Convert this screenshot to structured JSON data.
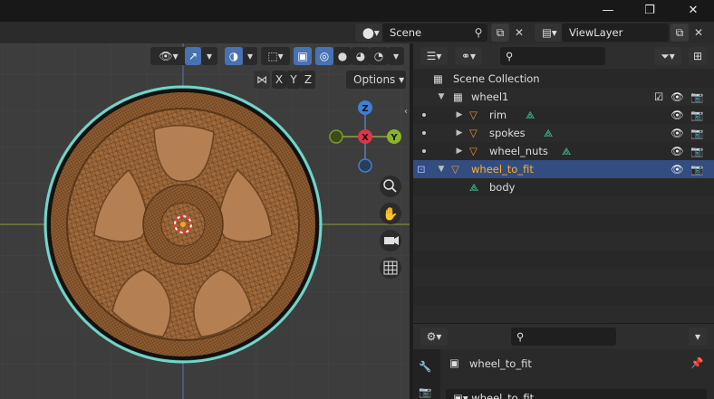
{
  "window": {
    "minimize_glyph": "—",
    "maximize_glyph": "❐",
    "close_glyph": "✕"
  },
  "scene_selector": {
    "value": "Scene"
  },
  "view_layer_selector": {
    "value": "ViewLayer"
  },
  "viewport": {
    "axis_x_label": "X",
    "axis_y_label": "Y",
    "axis_z_label": "Z",
    "mirror_x": "X",
    "mirror_y": "Y",
    "mirror_z": "Z",
    "options_label": "Options",
    "gizmo": {
      "z": "Z",
      "x": "X",
      "y": "Y"
    },
    "object_color": "#a0673a",
    "outline_color": "#6fd6c8"
  },
  "outliner": {
    "search_placeholder": "",
    "items": [
      {
        "label": "Scene Collection",
        "icon": "collection-box-icon"
      },
      {
        "label": "wheel1",
        "icon": "collection-box-icon"
      },
      {
        "label": "rim",
        "icon": "mesh-object-icon"
      },
      {
        "label": "spokes",
        "icon": "mesh-object-icon"
      },
      {
        "label": "wheel_nuts",
        "icon": "mesh-object-icon"
      },
      {
        "label": "wheel_to_fit",
        "icon": "mesh-object-icon"
      },
      {
        "label": "body",
        "icon": "mesh-data-icon"
      }
    ]
  },
  "properties": {
    "search_placeholder": "",
    "object_name": "wheel_to_fit",
    "name_field_value": "wheel_to_fit"
  }
}
